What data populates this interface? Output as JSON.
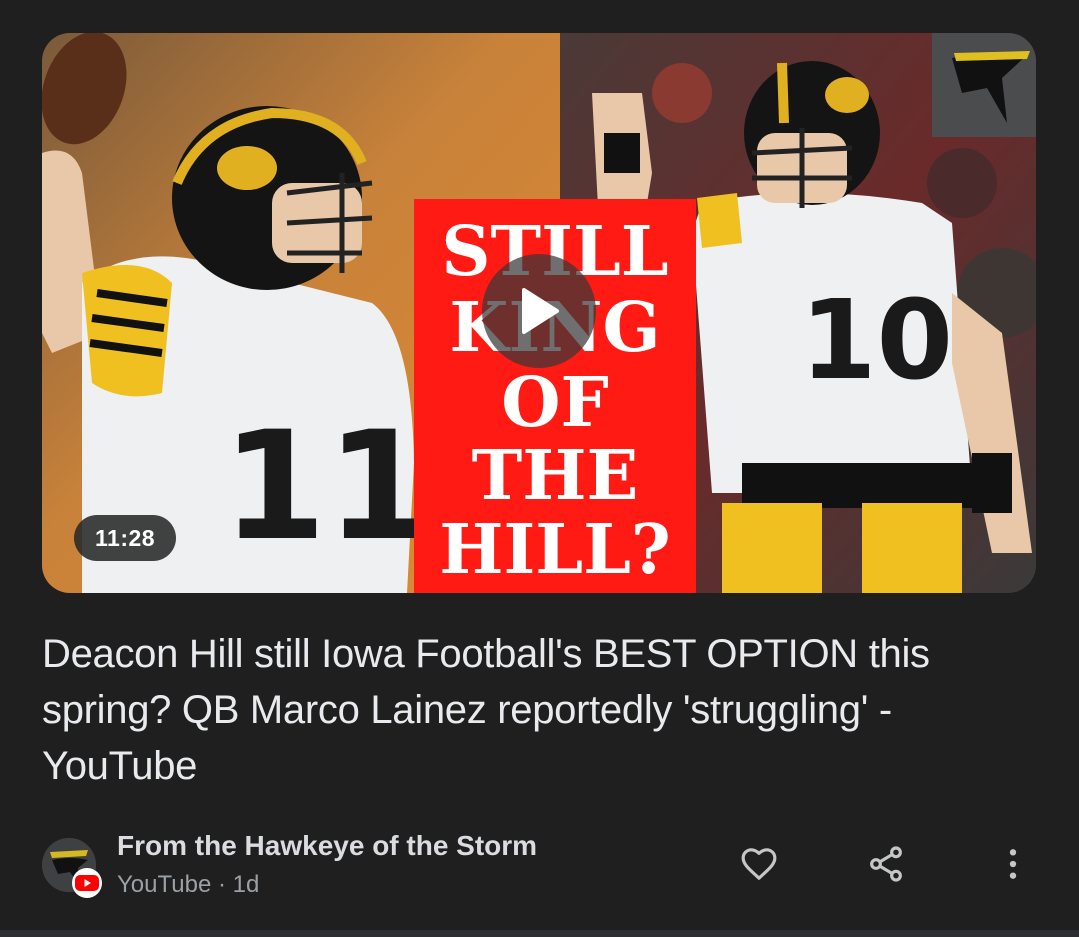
{
  "video": {
    "duration": "11:28",
    "title": "Deacon Hill still Iowa Football's BEST OPTION this spring? QB Marco Lainez reportedly 'struggling' - YouTube",
    "thumbnail_text": [
      "STILL",
      "KING",
      "OF",
      "THE",
      "HILL?"
    ],
    "jersey_left": "11",
    "jersey_right": "10"
  },
  "source": {
    "channel_name": "From the Hawkeye of the Storm",
    "platform": "YouTube",
    "separator": "·",
    "age": "1d"
  },
  "actions": {
    "like_icon": "heart-outline-icon",
    "share_icon": "share-icon",
    "more_icon": "more-vertical-icon"
  },
  "colors": {
    "background": "#1f1f1f",
    "thumb_banner_red": "#ff1a14",
    "iowa_gold": "#f0c020",
    "youtube_red": "#ff0000"
  }
}
